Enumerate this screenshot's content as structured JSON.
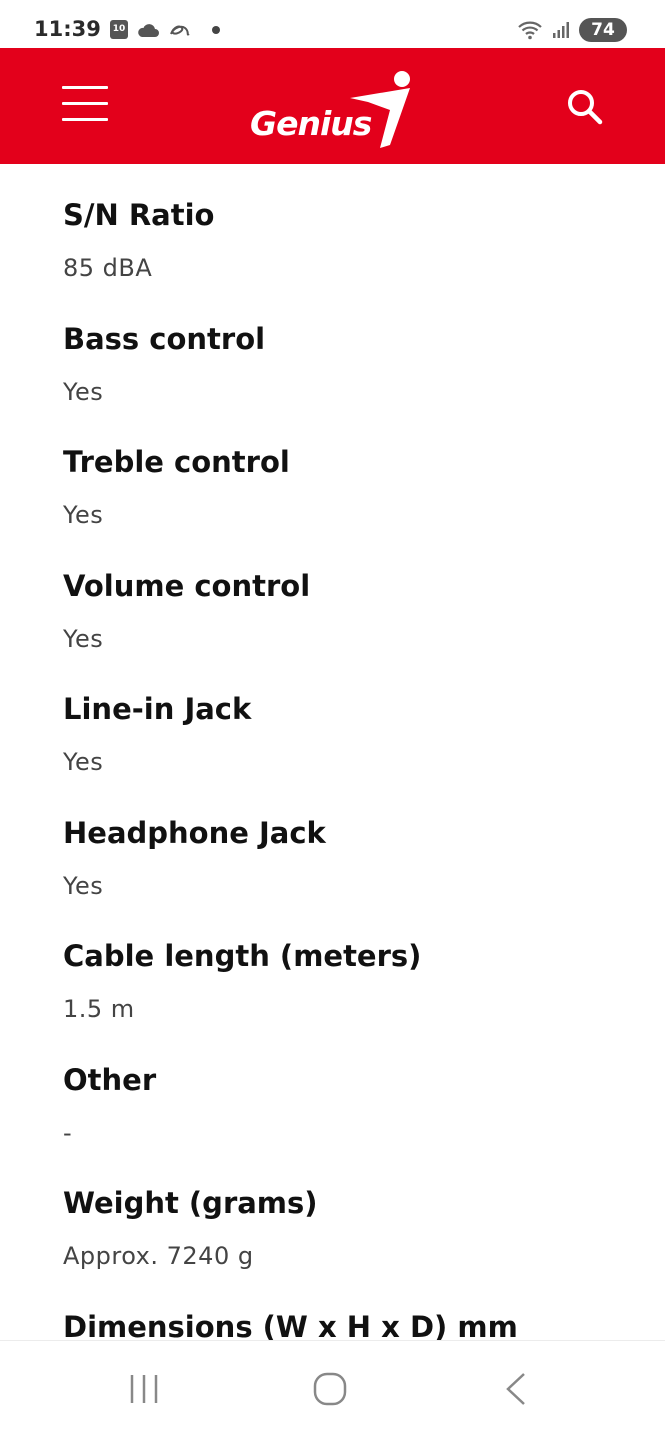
{
  "status_bar": {
    "time": "11:39",
    "calendar_day": "10",
    "battery": "74"
  },
  "header": {
    "brand": "Genius",
    "brand_color": "#e3001b"
  },
  "specs": [
    {
      "label": "S/N Ratio",
      "value": "85 dBA"
    },
    {
      "label": "Bass control",
      "value": "Yes"
    },
    {
      "label": "Treble control",
      "value": "Yes"
    },
    {
      "label": "Volume control",
      "value": "Yes"
    },
    {
      "label": "Line-in Jack",
      "value": "Yes"
    },
    {
      "label": "Headphone Jack",
      "value": "Yes"
    },
    {
      "label": "Cable length (meters)",
      "value": "1.5 m"
    },
    {
      "label": "Other",
      "value": "-"
    },
    {
      "label": "Weight (grams)",
      "value": "Approx. 7240 g"
    },
    {
      "label": "Dimensions (W x H x D) mm",
      "value": ""
    }
  ],
  "icons": {
    "menu": "hamburger-menu-icon",
    "search": "search-icon",
    "recents": "recent-apps-icon",
    "home": "home-icon",
    "back": "back-icon"
  }
}
